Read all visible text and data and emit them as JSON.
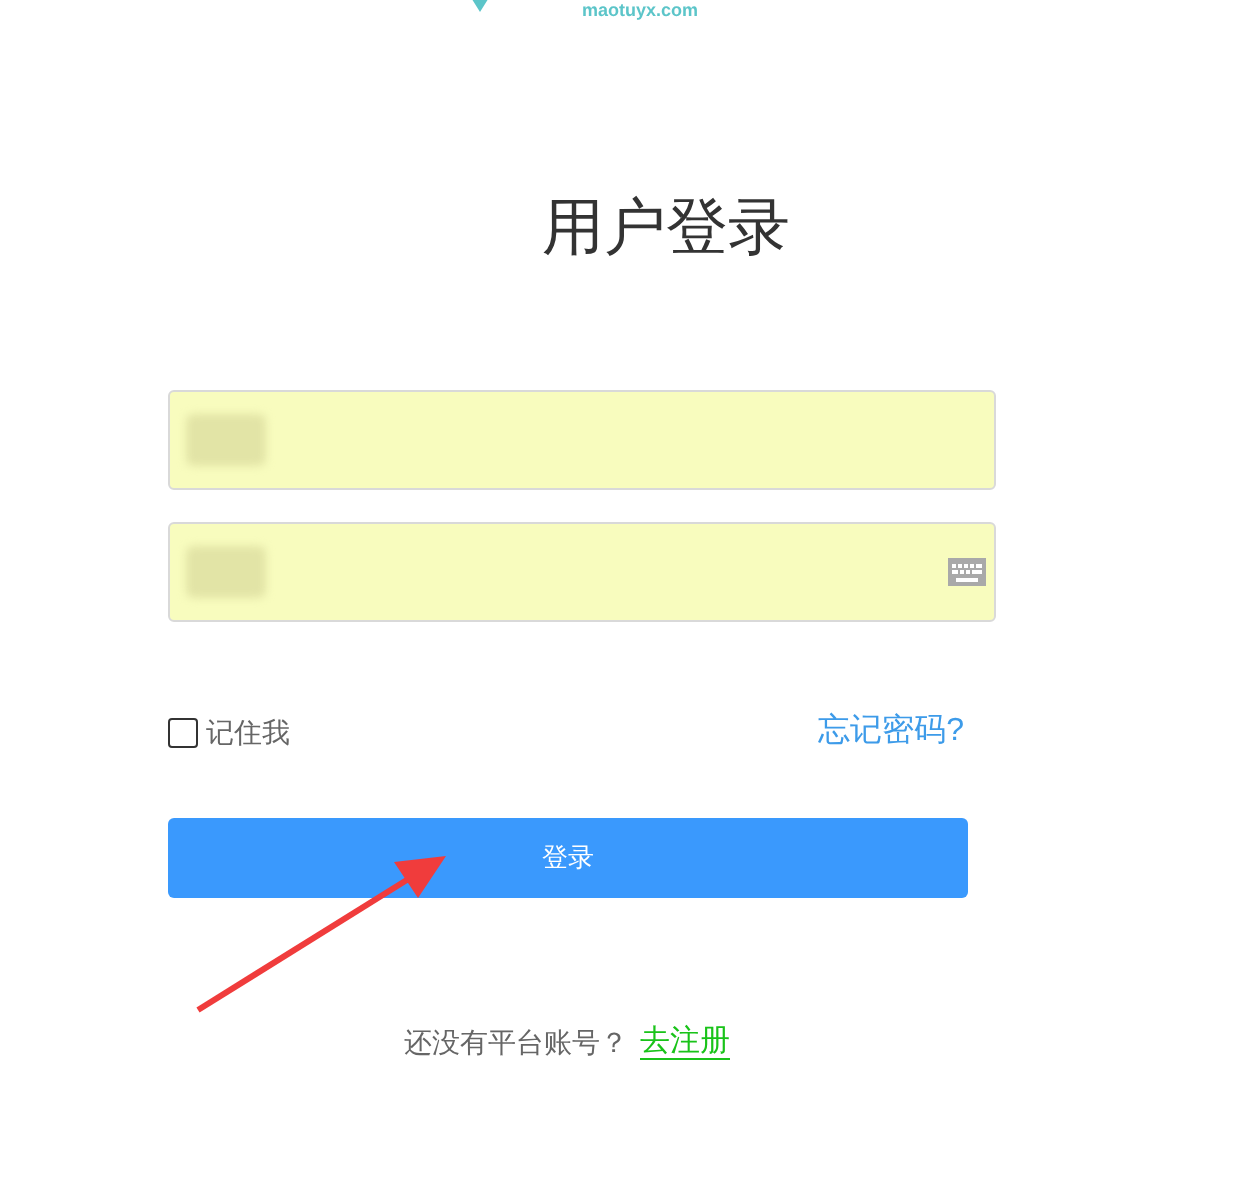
{
  "header": {
    "logo_text": "maotuyx.com"
  },
  "title": "用户登录",
  "fields": [
    {
      "kind": "text",
      "redacted": true
    },
    {
      "kind": "password",
      "redacted": true
    }
  ],
  "remember": {
    "label": "记住我",
    "checked": false
  },
  "forgot_link": "忘记密码?",
  "login_button": "登录",
  "register": {
    "prompt": "还没有平台账号？",
    "link": "去注册"
  }
}
